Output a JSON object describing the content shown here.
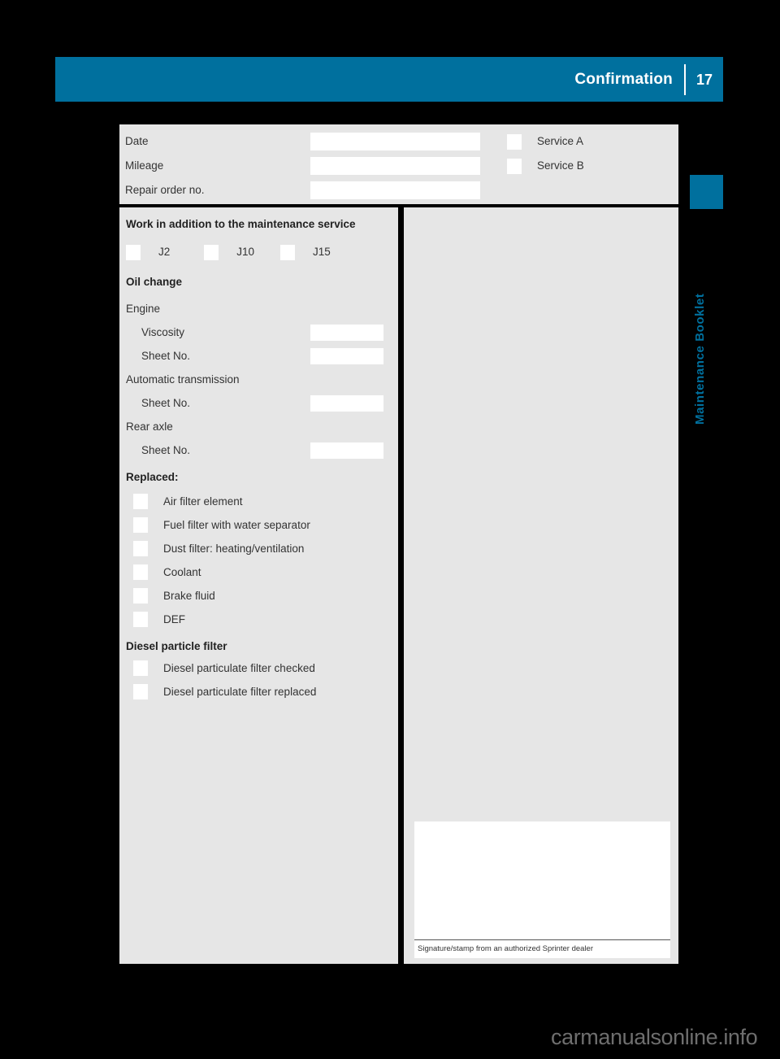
{
  "header": {
    "title": "Confirmation",
    "page_number": "17",
    "accent_color": "#00709e"
  },
  "side_tab": {
    "label": "Maintenance Booklet",
    "color": "#00709e"
  },
  "top_form": {
    "rows": [
      {
        "label": "Date",
        "value": ""
      },
      {
        "label": "Mileage",
        "value": ""
      },
      {
        "label": "Repair order no.",
        "value": ""
      }
    ],
    "service_options": [
      {
        "label": "Service A",
        "checked": false
      },
      {
        "label": "Service B",
        "checked": false
      }
    ]
  },
  "left_column": {
    "additional_work": {
      "heading": "Work in addition to the maintenance service",
      "options": [
        {
          "label": "J2",
          "checked": false
        },
        {
          "label": "J10",
          "checked": false
        },
        {
          "label": "J15",
          "checked": false
        }
      ]
    },
    "oil_change": {
      "heading": "Oil change",
      "groups": [
        {
          "group_label": "Engine",
          "fields": [
            {
              "label": "Viscosity",
              "value": ""
            },
            {
              "label": "Sheet No.",
              "value": ""
            }
          ]
        },
        {
          "group_label": "Automatic transmission",
          "fields": [
            {
              "label": "Sheet No.",
              "value": ""
            }
          ]
        },
        {
          "group_label": "Rear axle",
          "fields": [
            {
              "label": "Sheet No.",
              "value": ""
            }
          ]
        }
      ]
    },
    "replaced": {
      "heading": "Replaced:",
      "items": [
        {
          "label": "Air filter element",
          "checked": false
        },
        {
          "label": "Fuel filter with water separator",
          "checked": false
        },
        {
          "label": "Dust filter: heating/ventilation",
          "checked": false
        },
        {
          "label": "Coolant",
          "checked": false
        },
        {
          "label": "Brake fluid",
          "checked": false
        },
        {
          "label": "DEF",
          "checked": false
        }
      ]
    },
    "diesel_particle_filter": {
      "heading": "Diesel particle filter",
      "items": [
        {
          "label": "Diesel particulate filter checked",
          "checked": false
        },
        {
          "label": "Diesel particulate filter replaced",
          "checked": false
        }
      ]
    }
  },
  "right_column": {
    "signature": {
      "value": "",
      "caption": "Signature/stamp from an authorized Sprinter dealer"
    }
  },
  "watermark": {
    "text": "carmanualsonline.info"
  }
}
